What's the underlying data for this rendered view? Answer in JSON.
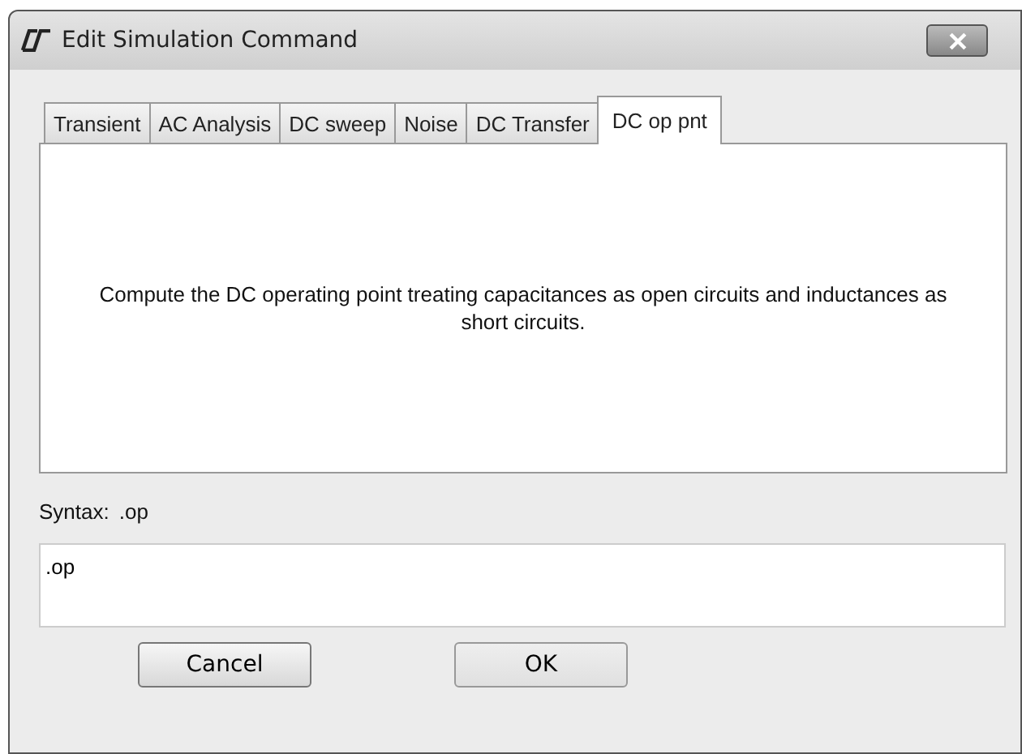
{
  "window": {
    "title": "Edit Simulation Command"
  },
  "tabs": [
    {
      "label": "Transient",
      "selected": false
    },
    {
      "label": "AC Analysis",
      "selected": false
    },
    {
      "label": "DC sweep",
      "selected": false
    },
    {
      "label": "Noise",
      "selected": false
    },
    {
      "label": "DC Transfer",
      "selected": false
    },
    {
      "label": "DC op pnt",
      "selected": true
    }
  ],
  "description": "Compute the DC operating point treating capacitances as open circuits and inductances as short circuits.",
  "syntax": {
    "label": "Syntax:",
    "value": ".op"
  },
  "command": {
    "value": ".op"
  },
  "buttons": [
    {
      "label": "Cancel",
      "default": false
    },
    {
      "label": "OK",
      "default": true
    }
  ]
}
